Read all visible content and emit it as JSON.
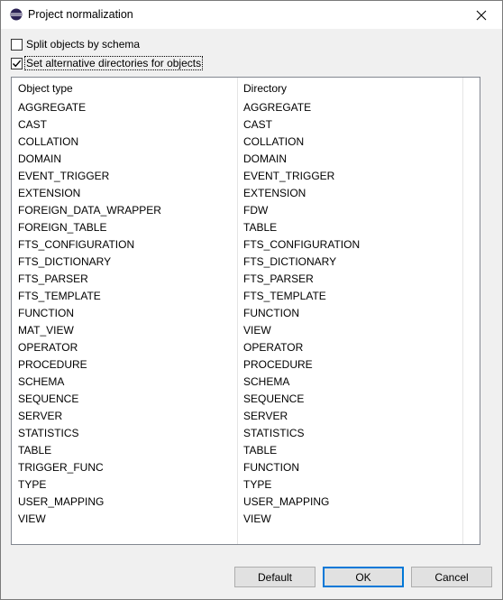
{
  "window": {
    "title": "Project normalization"
  },
  "options": {
    "split_label": "Split objects by schema",
    "split_checked": false,
    "altdir_label": "Set alternative directories for objects",
    "altdir_checked": true
  },
  "table": {
    "headers": {
      "object_type": "Object type",
      "directory": "Directory"
    },
    "rows": [
      {
        "object_type": "AGGREGATE",
        "directory": "AGGREGATE"
      },
      {
        "object_type": "CAST",
        "directory": "CAST"
      },
      {
        "object_type": "COLLATION",
        "directory": "COLLATION"
      },
      {
        "object_type": "DOMAIN",
        "directory": "DOMAIN"
      },
      {
        "object_type": "EVENT_TRIGGER",
        "directory": "EVENT_TRIGGER"
      },
      {
        "object_type": "EXTENSION",
        "directory": "EXTENSION"
      },
      {
        "object_type": "FOREIGN_DATA_WRAPPER",
        "directory": "FDW"
      },
      {
        "object_type": "FOREIGN_TABLE",
        "directory": "TABLE"
      },
      {
        "object_type": "FTS_CONFIGURATION",
        "directory": "FTS_CONFIGURATION"
      },
      {
        "object_type": "FTS_DICTIONARY",
        "directory": "FTS_DICTIONARY"
      },
      {
        "object_type": "FTS_PARSER",
        "directory": "FTS_PARSER"
      },
      {
        "object_type": "FTS_TEMPLATE",
        "directory": "FTS_TEMPLATE"
      },
      {
        "object_type": "FUNCTION",
        "directory": "FUNCTION"
      },
      {
        "object_type": "MAT_VIEW",
        "directory": "VIEW"
      },
      {
        "object_type": "OPERATOR",
        "directory": "OPERATOR"
      },
      {
        "object_type": "PROCEDURE",
        "directory": "PROCEDURE"
      },
      {
        "object_type": "SCHEMA",
        "directory": "SCHEMA"
      },
      {
        "object_type": "SEQUENCE",
        "directory": "SEQUENCE"
      },
      {
        "object_type": "SERVER",
        "directory": "SERVER"
      },
      {
        "object_type": "STATISTICS",
        "directory": "STATISTICS"
      },
      {
        "object_type": "TABLE",
        "directory": "TABLE"
      },
      {
        "object_type": "TRIGGER_FUNC",
        "directory": "FUNCTION"
      },
      {
        "object_type": "TYPE",
        "directory": "TYPE"
      },
      {
        "object_type": "USER_MAPPING",
        "directory": "USER_MAPPING"
      },
      {
        "object_type": "VIEW",
        "directory": "VIEW"
      }
    ]
  },
  "buttons": {
    "default_label": "Default",
    "ok_label": "OK",
    "cancel_label": "Cancel"
  },
  "colors": {
    "accent": "#0078d7",
    "icon_ring": "#2c2255",
    "icon_band": "#f7941e"
  },
  "icons": {
    "app": "eclipse-icon",
    "close": "close-icon",
    "check": "check-icon"
  }
}
